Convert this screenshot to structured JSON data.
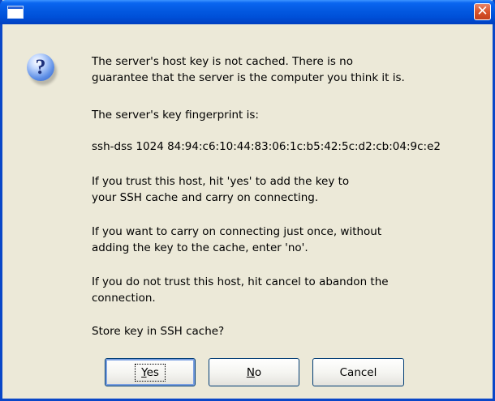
{
  "window": {
    "title": "",
    "close_glyph": "✕"
  },
  "dialog": {
    "icon": "question-icon",
    "icon_glyph": "?",
    "messages": [
      "The server's host key is not cached. There is no",
      "guarantee that the server is the computer you think it is.",
      "The server's key fingerprint is:",
      "ssh-dss 1024 84:94:c6:10:44:83:06:1c:b5:42:5c:d2:cb:04:9c:e2",
      "If you trust this host, hit 'yes' to add the key to",
      "your SSH cache and carry on connecting.",
      "If you want to carry on connecting just once, without",
      "adding the key to the cache, enter 'no'.",
      "If you do not trust this host, hit cancel to abandon the",
      "connection.",
      "Store key in SSH cache?"
    ]
  },
  "buttons": {
    "yes_label": "Yes",
    "no_label": "No",
    "cancel_label": "Cancel"
  }
}
